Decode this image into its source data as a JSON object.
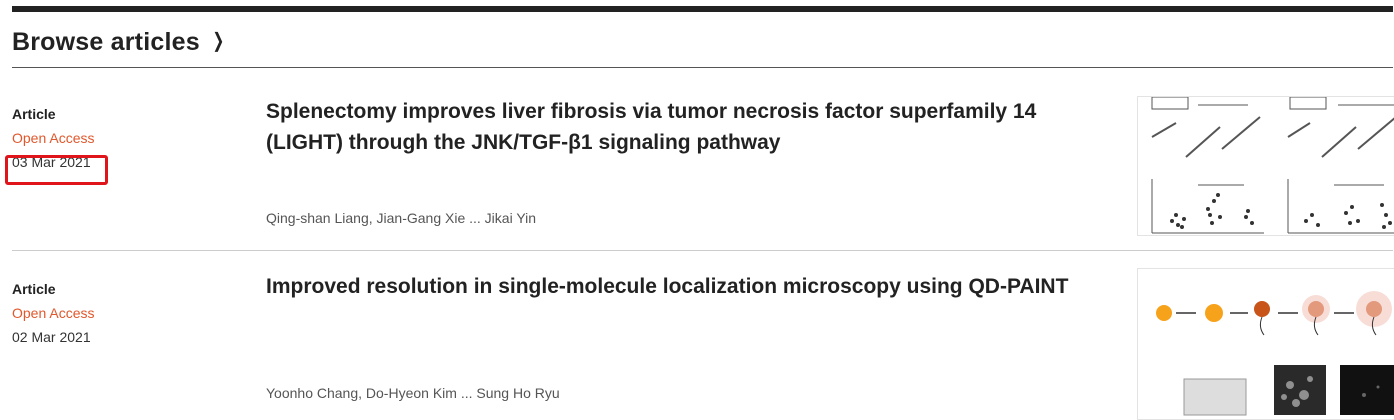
{
  "section": {
    "title": "Browse articles"
  },
  "articles": [
    {
      "type": "Article",
      "access": "Open Access",
      "date": "03 Mar 2021",
      "title": "Splenectomy improves liver fibrosis via tumor necrosis factor superfamily 14 (LIGHT) through the JNK/TGF-β1 signaling pathway",
      "authors": "Qing-shan Liang, Jian-Gang Xie ... Jikai Yin"
    },
    {
      "type": "Article",
      "access": "Open Access",
      "date": "02 Mar 2021",
      "title": "Improved resolution in single-molecule localization microscopy using QD-PAINT",
      "authors": "Yoonho Chang, Do-Hyeon Kim ... Sung Ho Ryu"
    }
  ],
  "colors": {
    "open_access": "#e0582c",
    "highlight_box": "#e0141b",
    "text": "#222222"
  },
  "icons": {
    "header_chevron": "chevron-right-icon"
  }
}
